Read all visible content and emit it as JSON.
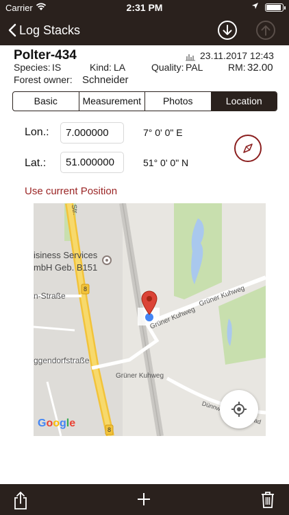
{
  "status_bar": {
    "carrier": "Carrier",
    "time": "2:31 PM"
  },
  "nav": {
    "back_label": "Log Stacks"
  },
  "header": {
    "title": "Polter-434",
    "date": "23.11.2017 12:43",
    "species_label": "Species:",
    "species_value": "IS",
    "kind_label": "Kind:",
    "kind_value": "LA",
    "quality_label": "Quality:",
    "quality_value": "PAL",
    "rm_label": "RM:",
    "rm_value": "32.00",
    "owner_label": "Forest owner:",
    "owner_value": "Schneider"
  },
  "tabs": [
    {
      "label": "Basic",
      "active": false
    },
    {
      "label": "Measurement",
      "active": false
    },
    {
      "label": "Photos",
      "active": false
    },
    {
      "label": "Location",
      "active": true
    }
  ],
  "location": {
    "lon_label": "Lon.:",
    "lon_value": "7.000000",
    "lon_dms": "7° 0' 0\" E",
    "lat_label": "Lat.:",
    "lat_value": "51.000000",
    "lat_dms": "51° 0' 0\" N",
    "use_current_position": "Use current Position"
  },
  "map": {
    "labels": [
      "isiness Services",
      "mbH Geb. B151",
      "n-Straße",
      "ggendorfstraße",
      "Grüner Kuhweg",
      "Grüner Kuhweg",
      "Grüner Kuhweg",
      "Dünnwalder Mauspfad",
      "Str.",
      "8",
      "8"
    ],
    "attribution": "Google"
  },
  "colors": {
    "bar": "#2a211d",
    "accent": "#9b2626",
    "pin": "#db4437"
  }
}
